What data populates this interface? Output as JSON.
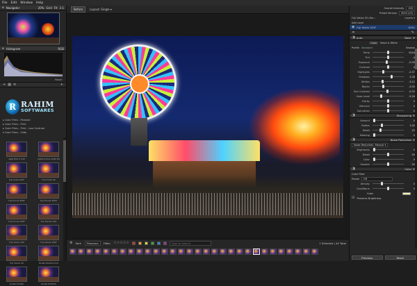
{
  "menu": [
    "File",
    "Edit",
    "Window",
    "Help"
  ],
  "left": {
    "navigator": {
      "title": "Navigator",
      "zoom_options": [
        "20%",
        "Grid",
        "Fit",
        "1:1"
      ]
    },
    "histogram": {
      "title": "Histogram",
      "mode": "RGB",
      "reset": "Reset"
    },
    "watermark": {
      "logo_letter": "R",
      "line1": "RAHIM",
      "line2": "SOFTWARES"
    },
    "tree": [
      "Color Films - Polaroid",
      "Color Films - Print",
      "Color Films - Print - Low Contrast",
      "Color Films - Slide"
    ],
    "presets": [
      "Agfa RSX II 100",
      "Agfachrome 1000 RS",
      "Fuji Astia 100F",
      "Fuji Fortia SP",
      "Fuji Provia 400F",
      "Fuji Provia 400X",
      "Fuji Provia 100F",
      "Fuji Sensia 100",
      "Fuji Velvia 100",
      "Fuji Velvia 100F",
      "Fuji Velvia 50",
      "Kodak Ektachrome",
      "Kodak E100G",
      "Kodak E100VS"
    ]
  },
  "center": {
    "before_label": "Before",
    "layout_label": "Layout: Single ▾",
    "film": {
      "sort_label": "Sort:",
      "sort_value": "Filename",
      "filter_label": "Filter:",
      "search_placeholder": "Type to search",
      "status": "1 Selected | 40 Total",
      "swatches": [
        "#c33",
        "#e8a530",
        "#dd3",
        "#3a3",
        "#38c",
        "#939",
        "#888"
      ]
    }
  },
  "right": {
    "overall_intensity_label": "Overall Intensity",
    "overall_intensity_value": "100",
    "preset_version_label": "Preset Version",
    "preset_version_value": "2020 (v3)",
    "layer_name": "Fuji Velvia 50 (Her...",
    "layers_label": "Layers ▾",
    "add_layer": "Add Layer",
    "layer_item": "Fuji Velvia 100F",
    "layer_opacity": "100%",
    "basic": {
      "title": "Basic",
      "auto": "Auto",
      "tab_color": "Color",
      "tab_bw": "Black & White",
      "profile_label": "Profile",
      "profile_value": "Standard",
      "browse": "Browse",
      "rows": [
        {
          "label": "Temp",
          "value": "2044",
          "pos": 0.5
        },
        {
          "label": "Tint",
          "value": "-4",
          "pos": 0.5
        },
        {
          "label": "Exposure",
          "value": "-0.55",
          "pos": 0.45
        },
        {
          "label": "Contrast",
          "value": "0",
          "pos": 0.5
        },
        {
          "label": "Highlights",
          "value": "-2.37",
          "pos": 0.35
        },
        {
          "label": "Shadows",
          "value": "2.28",
          "pos": 0.62
        },
        {
          "label": "Whites",
          "value": "-3.12",
          "pos": 0.33
        },
        {
          "label": "Blacks",
          "value": "-3.00",
          "pos": 0.34
        },
        {
          "label": "Dyn Contrast",
          "value": "-0.33",
          "pos": 0.48
        },
        {
          "label": "Haze Level",
          "value": "-5.26",
          "pos": 0.28
        },
        {
          "label": "Clarity",
          "value": "0",
          "pos": 0.5
        },
        {
          "label": "Vibrance",
          "value": "0",
          "pos": 0.5
        },
        {
          "label": "Saturation",
          "value": "0",
          "pos": 0.5
        }
      ]
    },
    "sharpening": {
      "title": "Sharpening",
      "rows": [
        {
          "label": "Amount",
          "value": "0",
          "pos": 0.05
        },
        {
          "label": "Radius",
          "value": "1.00",
          "pos": 0.3
        },
        {
          "label": "Detail",
          "value": "25",
          "pos": 0.25
        },
        {
          "label": "Masking",
          "value": "0",
          "pos": 0.05
        }
      ]
    },
    "noise": {
      "title": "Noise Reduction",
      "mode_label": "Noise Reduction: Manual ▾",
      "rows": [
        {
          "label": "Brightness",
          "value": "0",
          "pos": 0.05
        },
        {
          "label": "Detail",
          "value": "50",
          "pos": 0.5
        },
        {
          "label": "Color",
          "value": "0",
          "pos": 0.05
        },
        {
          "label": "Smooth",
          "value": "50",
          "pos": 0.5
        }
      ]
    },
    "color": {
      "title": "Color",
      "filter_label": "Color Filter",
      "preset_label": "Preset",
      "preset_value": "Off",
      "rows": [
        {
          "label": "Density",
          "value": "0",
          "pos": 0.3
        },
        {
          "label": "Cool/Warm",
          "value": "0",
          "pos": 0.5
        }
      ],
      "color_label": "Color",
      "preserve": "Preserve Brightness",
      "swatch": "#f2efb0"
    },
    "buttons": {
      "previous": "Previous",
      "reset": "Reset"
    }
  }
}
